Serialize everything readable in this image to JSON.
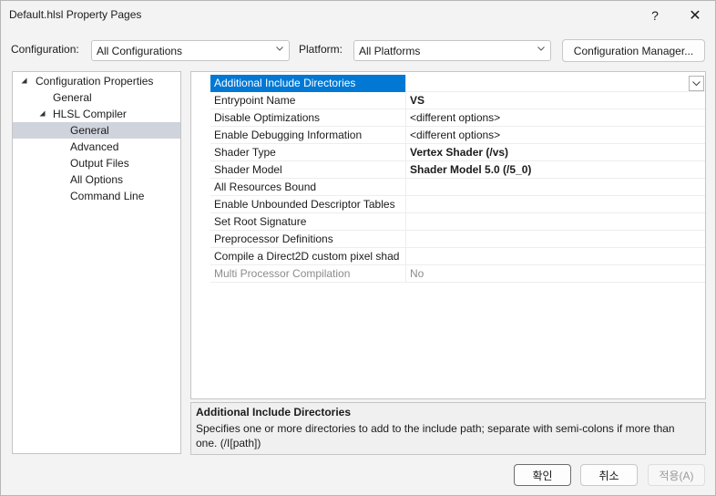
{
  "window": {
    "title": "Default.hlsl Property Pages",
    "help_glyph": "?",
    "close_glyph": "✕"
  },
  "configuration": {
    "label": "Configuration:",
    "value": "All Configurations"
  },
  "platform": {
    "label": "Platform:",
    "value": "All Platforms"
  },
  "configuration_manager_label": "Configuration Manager...",
  "tree": {
    "items": [
      {
        "label": "Configuration Properties",
        "expanded": true
      },
      {
        "label": "General"
      },
      {
        "label": "HLSL Compiler",
        "expanded": true
      },
      {
        "label": "General",
        "selected": true
      },
      {
        "label": "Advanced"
      },
      {
        "label": "Output Files"
      },
      {
        "label": "All Options"
      },
      {
        "label": "Command Line"
      }
    ]
  },
  "properties": [
    {
      "name": "Additional Include Directories",
      "value": "",
      "selected": true
    },
    {
      "name": "Entrypoint Name",
      "value": "VS",
      "bold": true
    },
    {
      "name": "Disable Optimizations",
      "value": "<different options>"
    },
    {
      "name": "Enable Debugging Information",
      "value": "<different options>"
    },
    {
      "name": "Shader Type",
      "value": "Vertex Shader (/vs)",
      "bold": true
    },
    {
      "name": "Shader Model",
      "value": "Shader Model 5.0 (/5_0)",
      "bold": true
    },
    {
      "name": "All Resources Bound",
      "value": ""
    },
    {
      "name": "Enable Unbounded Descriptor Tables",
      "value": ""
    },
    {
      "name": "Set Root Signature",
      "value": ""
    },
    {
      "name": "Preprocessor Definitions",
      "value": ""
    },
    {
      "name": "Compile a Direct2D custom pixel shad",
      "value": ""
    },
    {
      "name": "Multi Processor Compilation",
      "value": "No",
      "disabled": true
    }
  ],
  "description": {
    "title": "Additional Include Directories",
    "text": "Specifies one or more directories to add to the include path; separate with semi-colons if more than one. (/I[path])"
  },
  "buttons": {
    "ok": "확인",
    "cancel": "취소",
    "apply": "적용(A)"
  }
}
